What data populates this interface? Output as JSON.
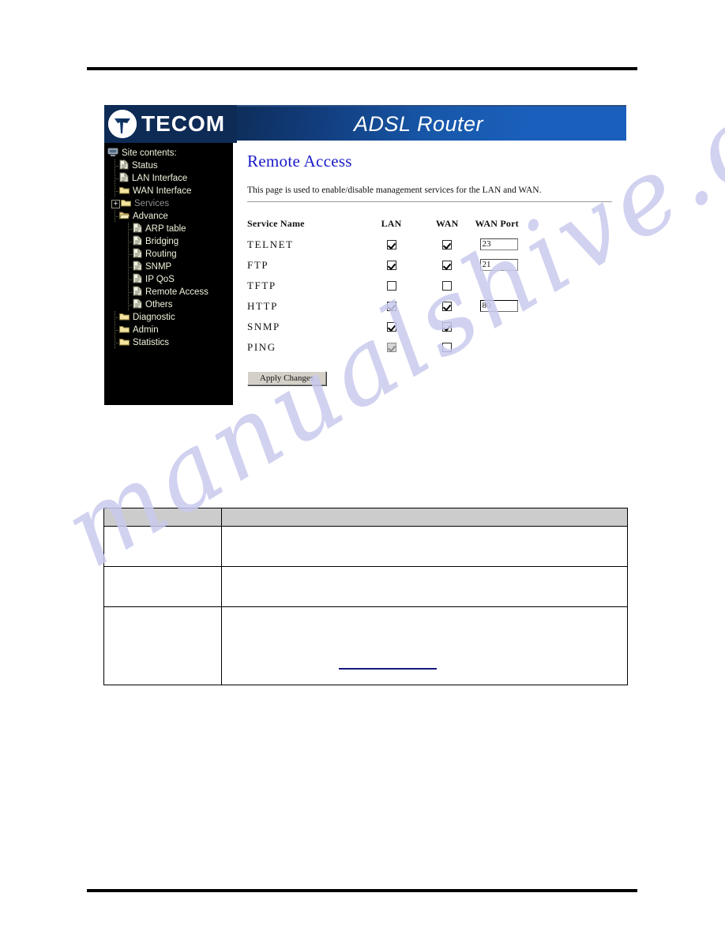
{
  "document": {
    "watermark": "manualshive.com"
  },
  "router": {
    "brand": "TECOM",
    "banner_title": "ADSL Router",
    "brand_logo_icon": "tecom-logo-icon"
  },
  "sidebar": {
    "root_label": "Site contents:",
    "root_icon": "computer-icon",
    "items": [
      {
        "label": "Status",
        "icon": "page-icon",
        "level": 1,
        "state": "normal",
        "expander": false
      },
      {
        "label": "LAN Interface",
        "icon": "page-icon",
        "level": 1,
        "state": "normal",
        "expander": false
      },
      {
        "label": "WAN Interface",
        "icon": "folder-icon",
        "level": 1,
        "state": "normal",
        "expander": false
      },
      {
        "label": "Services",
        "icon": "folder-icon",
        "level": 1,
        "state": "disabled",
        "expander": true,
        "expander_glyph": "+"
      },
      {
        "label": "Advance",
        "icon": "folder-open-icon",
        "level": 1,
        "state": "selected",
        "expander": false
      },
      {
        "label": "ARP table",
        "icon": "page-icon",
        "level": 2,
        "state": "normal",
        "expander": false
      },
      {
        "label": "Bridging",
        "icon": "page-icon",
        "level": 2,
        "state": "normal",
        "expander": false
      },
      {
        "label": "Routing",
        "icon": "page-icon",
        "level": 2,
        "state": "normal",
        "expander": false
      },
      {
        "label": "SNMP",
        "icon": "page-icon",
        "level": 2,
        "state": "normal",
        "expander": false
      },
      {
        "label": "IP QoS",
        "icon": "page-icon",
        "level": 2,
        "state": "normal",
        "expander": false
      },
      {
        "label": "Remote Access",
        "icon": "page-icon",
        "level": 2,
        "state": "active",
        "expander": false
      },
      {
        "label": "Others",
        "icon": "page-icon",
        "level": 2,
        "state": "normal",
        "expander": false
      },
      {
        "label": "Diagnostic",
        "icon": "folder-icon",
        "level": 1,
        "state": "normal",
        "expander": false
      },
      {
        "label": "Admin",
        "icon": "folder-icon",
        "level": 1,
        "state": "normal",
        "expander": false
      },
      {
        "label": "Statistics",
        "icon": "folder-icon",
        "level": 1,
        "state": "normal",
        "expander": false
      }
    ]
  },
  "main": {
    "title": "Remote Access",
    "description": "This page is used to enable/disable management services for the LAN and WAN.",
    "columns": {
      "service": "Service Name",
      "lan": "LAN",
      "wan": "WAN",
      "wan_port": "WAN Port"
    },
    "rows": [
      {
        "service": "TELNET",
        "lan_checked": true,
        "lan_disabled": false,
        "wan_checked": true,
        "port": "23",
        "has_port": true
      },
      {
        "service": "FTP",
        "lan_checked": true,
        "lan_disabled": false,
        "wan_checked": true,
        "port": "21",
        "has_port": true
      },
      {
        "service": "TFTP",
        "lan_checked": false,
        "lan_disabled": false,
        "wan_checked": false,
        "port": "",
        "has_port": false
      },
      {
        "service": "HTTP",
        "lan_checked": true,
        "lan_disabled": false,
        "wan_checked": true,
        "port": "80",
        "has_port": true,
        "port_focused": true
      },
      {
        "service": "SNMP",
        "lan_checked": true,
        "lan_disabled": false,
        "wan_checked": true,
        "port": "",
        "has_port": false
      },
      {
        "service": "PING",
        "lan_checked": true,
        "lan_disabled": true,
        "wan_checked": false,
        "port": "",
        "has_port": false
      }
    ],
    "apply_label": "Apply Changes"
  },
  "doc_table": {
    "header": [
      "",
      ""
    ],
    "rows": [
      [
        "",
        ""
      ],
      [
        "",
        ""
      ],
      [
        "",
        ""
      ]
    ]
  }
}
